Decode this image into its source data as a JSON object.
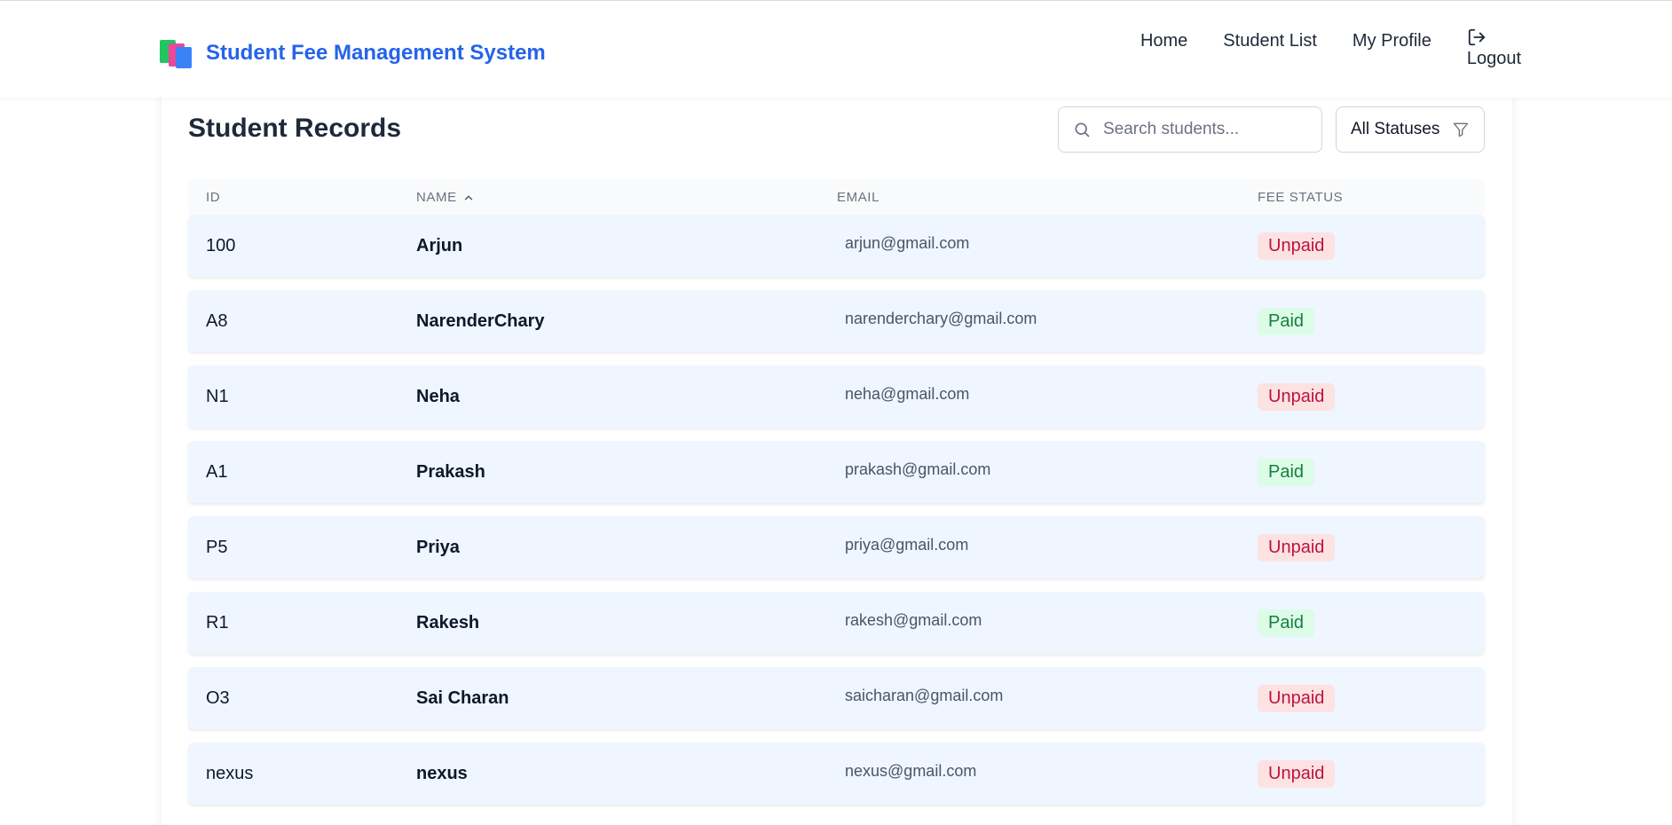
{
  "header": {
    "app_title": "Student Fee Management System",
    "logo_icon": "books-icon",
    "nav": [
      {
        "label": "Home"
      },
      {
        "label": "Student List"
      },
      {
        "label": "My Profile"
      }
    ],
    "logout_label": "Logout",
    "logout_icon": "logout-icon"
  },
  "main": {
    "title": "Student Records",
    "search": {
      "placeholder": "Search students...",
      "value": ""
    },
    "status_filter": {
      "selected": "All Statuses",
      "icon": "filter-icon"
    },
    "columns": [
      {
        "label": "ID"
      },
      {
        "label": "NAME",
        "sort": "ascending"
      },
      {
        "label": "EMAIL"
      },
      {
        "label": "FEE STATUS"
      }
    ],
    "rows": [
      {
        "id": "100",
        "name": "Arjun",
        "email": "arjun@gmail.com",
        "status": "Unpaid"
      },
      {
        "id": "A8",
        "name": "NarenderChary",
        "email": "narenderchary@gmail.com",
        "status": "Paid"
      },
      {
        "id": "N1",
        "name": "Neha",
        "email": "neha@gmail.com",
        "status": "Unpaid"
      },
      {
        "id": "A1",
        "name": "Prakash",
        "email": "prakash@gmail.com",
        "status": "Paid"
      },
      {
        "id": "P5",
        "name": "Priya",
        "email": "priya@gmail.com",
        "status": "Unpaid"
      },
      {
        "id": "R1",
        "name": "Rakesh",
        "email": "rakesh@gmail.com",
        "status": "Paid"
      },
      {
        "id": "O3",
        "name": "Sai Charan",
        "email": "saicharan@gmail.com",
        "status": "Unpaid"
      },
      {
        "id": "nexus",
        "name": "nexus",
        "email": "nexus@gmail.com",
        "status": "Unpaid"
      }
    ]
  },
  "colors": {
    "brand": "#2563eb",
    "row_bg": "#eff6ff",
    "unpaid_bg": "#fde2e4",
    "unpaid_text": "#be123c",
    "paid_bg": "#dcfce7",
    "paid_text": "#15803d"
  }
}
